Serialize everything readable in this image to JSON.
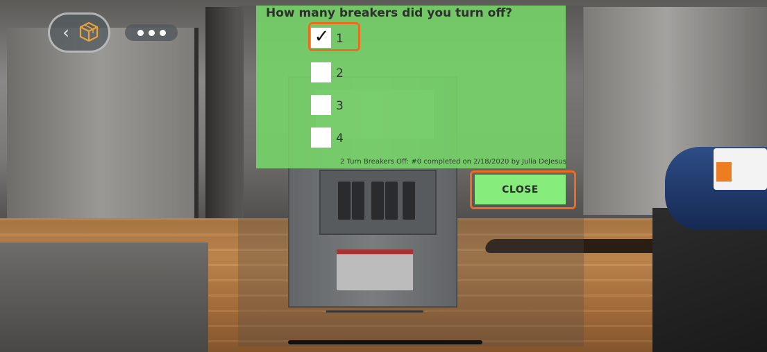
{
  "dialog": {
    "question": "How many breakers did you turn off?",
    "options": [
      {
        "label": "1",
        "checked": true
      },
      {
        "label": "2",
        "checked": false
      },
      {
        "label": "3",
        "checked": false
      },
      {
        "label": "4",
        "checked": false
      }
    ],
    "check_glyph": "✓",
    "completion_text": "2 Turn Breakers Off: #0 completed on 2/18/2020 by Julia DeJesus",
    "close_label": "CLOSE"
  },
  "nav": {
    "back_icon": "chevron-left-icon",
    "model_icon": "cube-icon",
    "more_icon": "more-dots-icon",
    "back_glyph": "‹"
  },
  "colors": {
    "panel_green": "#76d669",
    "button_green": "#86ec7b",
    "highlight_orange": "#ef6c1e"
  }
}
